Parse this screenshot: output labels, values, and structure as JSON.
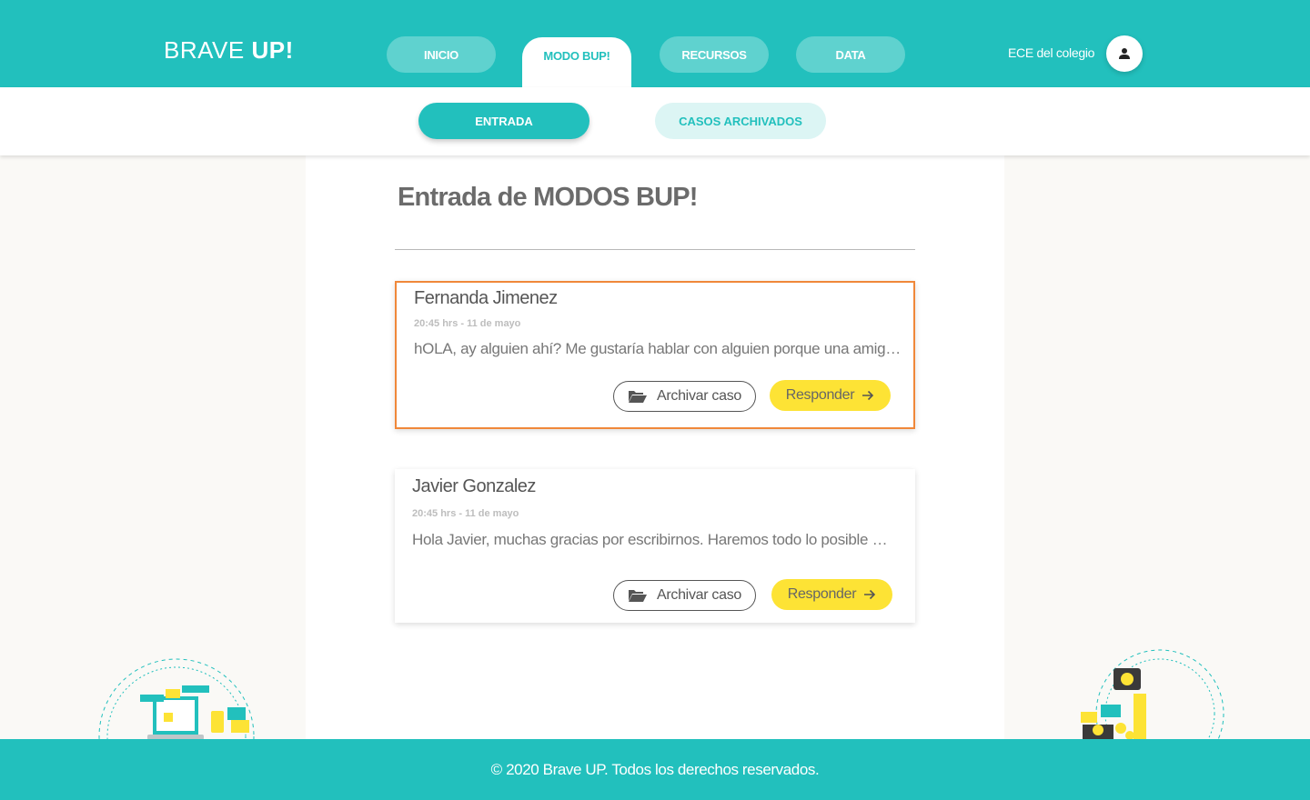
{
  "header": {
    "logo_light": "BRAVE",
    "logo_bold": "UP!",
    "nav": [
      {
        "label": "INICIO"
      },
      {
        "label": "MODO BUP!"
      },
      {
        "label": "RECURSOS"
      },
      {
        "label": "DATA"
      }
    ],
    "active_nav": "MODO BUP!",
    "user_label": "ECE del colegio",
    "avatar_icon": "user-icon"
  },
  "subnav": {
    "tabs": [
      {
        "label": "ENTRADA"
      },
      {
        "label": "CASOS ARCHIVADOS"
      }
    ],
    "active_tab": "ENTRADA"
  },
  "main": {
    "title": "Entrada de MODOS BUP!",
    "cases": [
      {
        "name": "Fernanda Jimenez",
        "time": "20:45 hrs - 11 de mayo",
        "message": "hOLA, ay alguien ahí? Me gustaría hablar con alguien porque una amiga me contó algo",
        "archive_label": "Archivar caso",
        "reply_label": "Responder",
        "selected": true
      },
      {
        "name": "Javier Gonzalez",
        "time": "20:45 hrs - 11 de mayo",
        "message": "Hola Javier, muchas gracias por escribirnos. Haremos todo lo posible por ayudarte",
        "archive_label": "Archivar caso",
        "reply_label": "Responder",
        "selected": false
      }
    ]
  },
  "footer": {
    "text": "© 2020 Brave UP. Todos los derechos reservados."
  },
  "colors": {
    "brand": "#22c0bd",
    "accent_yellow": "#fde335",
    "selected_border": "#f0883a"
  }
}
